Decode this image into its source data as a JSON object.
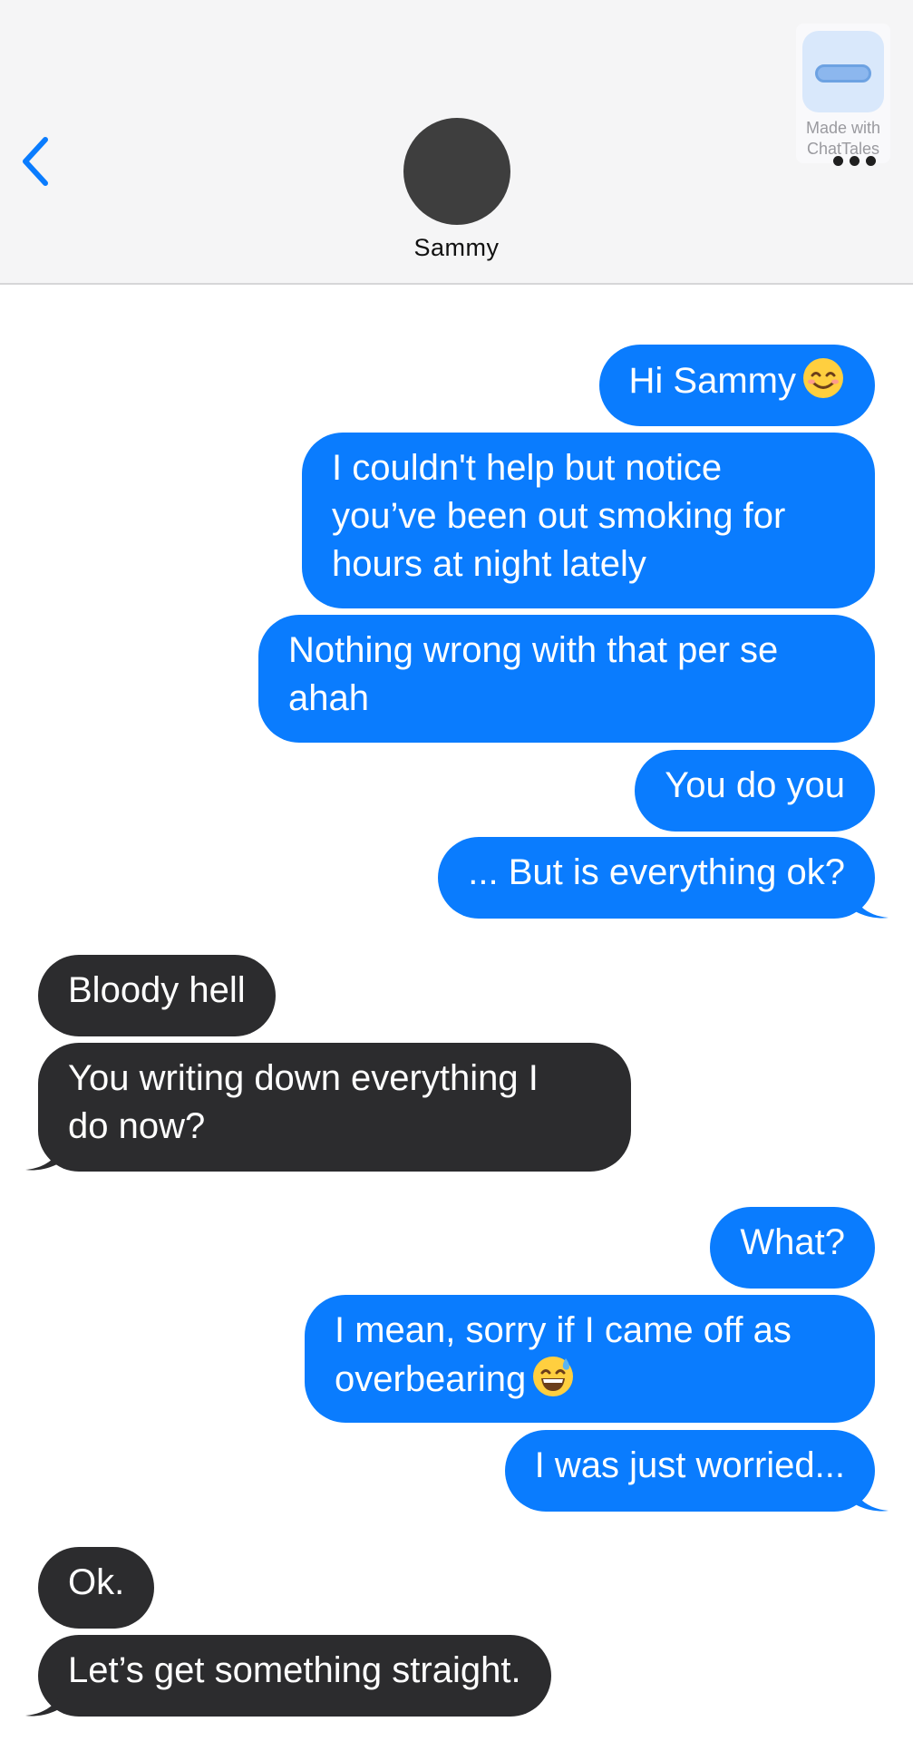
{
  "header": {
    "contact_name": "Sammy",
    "watermark_line1": "Made with",
    "watermark_line2": "ChatTales"
  },
  "colors": {
    "outgoing_bubble": "#0a7cfe",
    "incoming_bubble": "#2c2c2e",
    "accent": "#0a7cfe",
    "header_bg": "#f5f5f6"
  },
  "icons": {
    "back": "chevron-left-icon",
    "more": "ellipsis-icon",
    "emoji1": "smiling-face-icon",
    "emoji2": "grinning-face-with-sweat-icon"
  },
  "messages": [
    {
      "from": "me",
      "text": "Hi Sammy"
    },
    {
      "from": "me",
      "lines": [
        "I couldn't help but notice",
        "you’ve been out smoking for",
        "hours at night lately"
      ]
    },
    {
      "from": "me",
      "lines": [
        "Nothing wrong with that per se",
        "ahah"
      ]
    },
    {
      "from": "me",
      "text": "You do you"
    },
    {
      "from": "me",
      "text": "... But is everything ok?"
    },
    {
      "from": "them",
      "text": "Bloody hell"
    },
    {
      "from": "them",
      "lines": [
        "You writing down everything I",
        "do now?"
      ]
    },
    {
      "from": "me",
      "text": "What?"
    },
    {
      "from": "me",
      "lines": [
        "I mean, sorry if I came off as",
        "overbearing"
      ]
    },
    {
      "from": "me",
      "text": "I was just worried..."
    },
    {
      "from": "them",
      "text": "Ok."
    },
    {
      "from": "them",
      "text": "Let’s get something straight."
    }
  ]
}
